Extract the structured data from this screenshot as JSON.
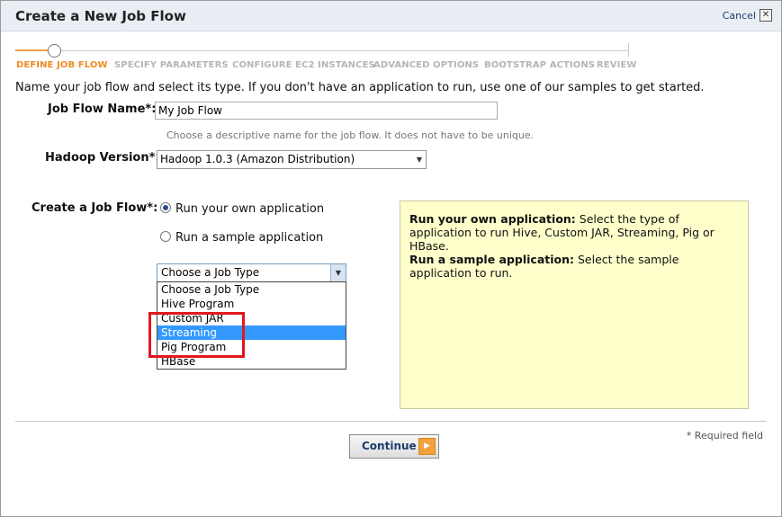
{
  "window": {
    "title": "Create a New Job Flow",
    "cancel_label": "Cancel",
    "close_glyph": "✕"
  },
  "steps": [
    "DEFINE JOB FLOW",
    "SPECIFY PARAMETERS",
    "CONFIGURE EC2 INSTANCES",
    "ADVANCED OPTIONS",
    "BOOTSTRAP ACTIONS",
    "REVIEW"
  ],
  "intro": "Name your job flow and select its type. If you don't have an application to run, use one of our samples to get started.",
  "job_flow_name": {
    "label": "Job Flow Name*:",
    "value": "My Job Flow",
    "hint": "Choose a descriptive name for the job flow. It does not have to be unique."
  },
  "hadoop_version": {
    "label": "Hadoop Version*:",
    "value": "Hadoop 1.0.3 (Amazon Distribution)"
  },
  "create": {
    "label": "Create a Job Flow*:",
    "options": [
      "Run your own application",
      "Run a sample application"
    ],
    "selected": "Run your own application"
  },
  "job_type": {
    "value": "Choose a Job Type",
    "options": [
      "Choose a Job Type",
      "Hive Program",
      "Custom JAR",
      "Streaming",
      "Pig Program",
      "HBase"
    ],
    "highlighted": "Streaming"
  },
  "info": {
    "own_title": "Run your own application:",
    "own_text": " Select the type of application to run Hive, Custom JAR, Streaming, Pig or HBase.",
    "sample_title": "Run a sample application:",
    "sample_text": " Select the sample application to run."
  },
  "required_note": "* Required field",
  "continue_label": "Continue",
  "colors": {
    "accent": "#f08a24",
    "highlight": "#3399ff",
    "info_bg": "#ffffcc",
    "annotation": "#e0181e"
  }
}
